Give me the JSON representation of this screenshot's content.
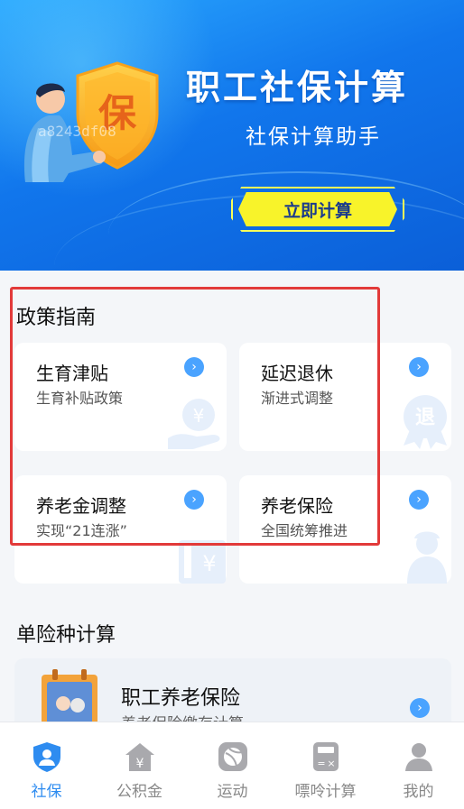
{
  "banner": {
    "title": "职工社保计算",
    "subtitle": "社保计算助手",
    "cta_label": "立即计算",
    "shield_char": "保",
    "watermark": "a8243df08"
  },
  "policy": {
    "title": "政策指南",
    "cards": [
      {
        "title": "生育津贴",
        "subtitle": "生育补贴政策",
        "icon": "yen-hand-icon"
      },
      {
        "title": "延迟退休",
        "subtitle": "渐进式调整",
        "icon": "retire-badge-icon",
        "badge_char": "退"
      },
      {
        "title": "养老金调整",
        "subtitle": "实现“21连涨”",
        "icon": "yen-document-icon"
      },
      {
        "title": "养老保险",
        "subtitle": "全国统筹推进",
        "icon": "elderly-person-icon"
      }
    ]
  },
  "single": {
    "title": "单险种计算",
    "card": {
      "title": "职工养老保险",
      "subtitle": "养老保险缴存计算"
    }
  },
  "tabs": [
    {
      "label": "社保",
      "icon": "shield-person-icon",
      "active": true
    },
    {
      "label": "公积金",
      "icon": "house-yen-icon",
      "active": false
    },
    {
      "label": "运动",
      "icon": "ball-icon",
      "active": false
    },
    {
      "label": "嘌呤计算",
      "icon": "calculator-icon",
      "active": false
    },
    {
      "label": "我的",
      "icon": "user-icon",
      "active": false
    }
  ],
  "colors": {
    "accent": "#2e8cf0",
    "banner": "#1176ec",
    "cta": "#f8f32a",
    "highlight": "#e23a3a"
  }
}
